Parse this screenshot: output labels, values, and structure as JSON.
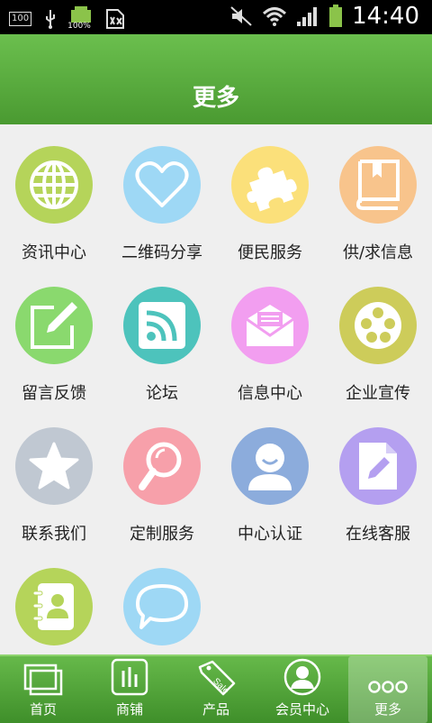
{
  "status_bar": {
    "time": "14:40",
    "battery_text": "100%"
  },
  "header": {
    "title": "更多"
  },
  "grid": [
    {
      "label": "资讯中心",
      "icon": "globe-icon",
      "color": "#b5d45a"
    },
    {
      "label": "二维码分享",
      "icon": "heart-icon",
      "color": "#9ed8f5"
    },
    {
      "label": "便民服务",
      "icon": "puzzle-icon",
      "color": "#fbe07a"
    },
    {
      "label": "供/求信息",
      "icon": "book-icon",
      "color": "#f8c48c"
    },
    {
      "label": "留言反馈",
      "icon": "pencil-icon",
      "color": "#8ad96e"
    },
    {
      "label": "论坛",
      "icon": "rss-icon",
      "color": "#4dc3bc"
    },
    {
      "label": "信息中心",
      "icon": "envelope-icon",
      "color": "#f29ef0"
    },
    {
      "label": "企业宣传",
      "icon": "film-reel-icon",
      "color": "#cdcc5a"
    },
    {
      "label": "联系我们",
      "icon": "star-icon",
      "color": "#c0c8d2"
    },
    {
      "label": "定制服务",
      "icon": "magnifier-icon",
      "color": "#f7a0aa"
    },
    {
      "label": "中心认证",
      "icon": "user-icon",
      "color": "#8cacdc"
    },
    {
      "label": "在线客服",
      "icon": "document-edit-icon",
      "color": "#b49ff0"
    },
    {
      "label": "",
      "icon": "contacts-icon",
      "color": "#b5d45a"
    },
    {
      "label": "",
      "icon": "chat-bubble-icon",
      "color": "#9ed8f5"
    }
  ],
  "tabs": [
    {
      "label": "首页",
      "icon": "home-icon"
    },
    {
      "label": "商铺",
      "icon": "shop-icon"
    },
    {
      "label": "产品",
      "icon": "sale-tag-icon",
      "tag_text": "Sale"
    },
    {
      "label": "会员中心",
      "icon": "member-icon"
    },
    {
      "label": "更多",
      "icon": "more-dots-icon",
      "active": true
    }
  ]
}
